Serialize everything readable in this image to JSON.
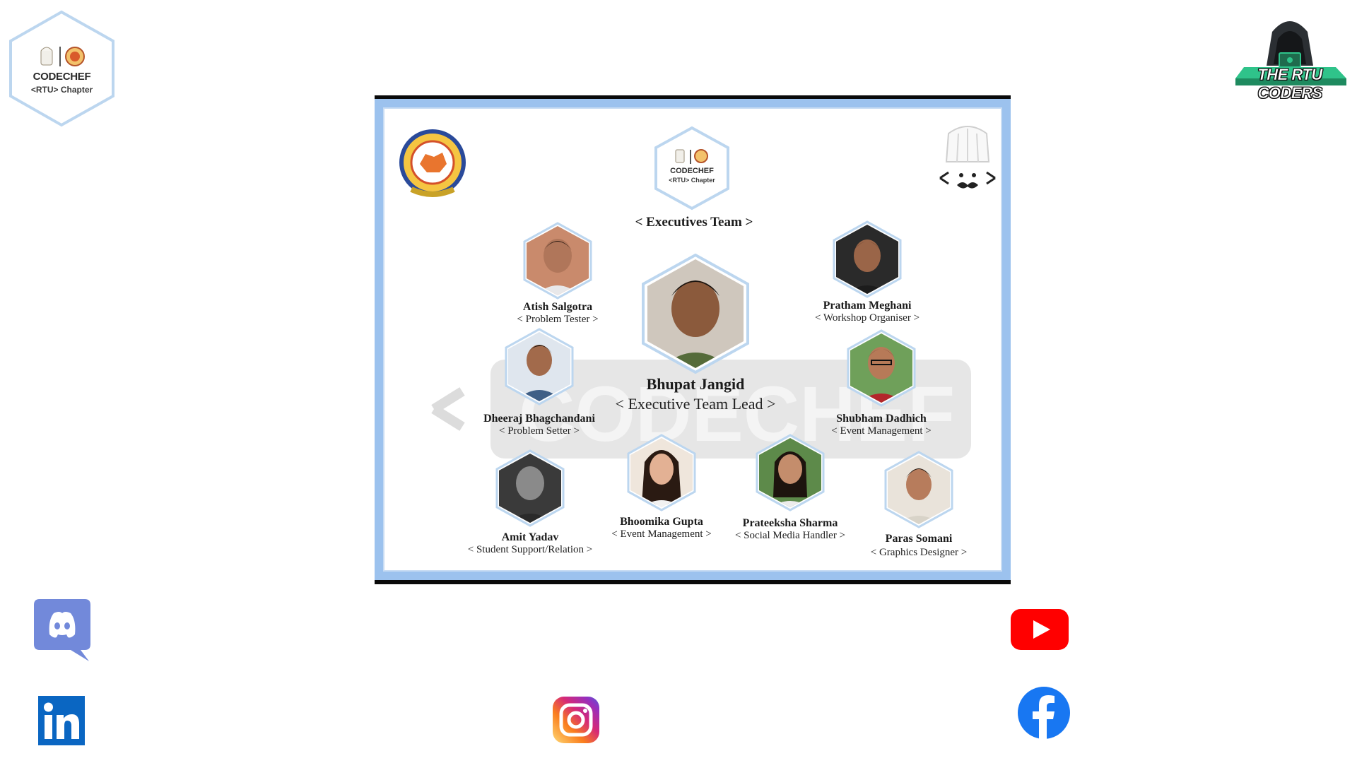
{
  "corner_logos": {
    "codechef_badge": {
      "title": "CODECHEF",
      "subtitle": "<RTU> Chapter"
    },
    "rtu_coders": {
      "text": "THE RTU CODERS"
    }
  },
  "poster": {
    "badge": {
      "title": "CODECHEF",
      "subtitle": "<RTU> Chapter"
    },
    "heading": "< Executives Team >",
    "members": [
      {
        "name": "Bhupat Jangid",
        "role": "< Executive Team Lead >"
      },
      {
        "name": "Atish Salgotra",
        "role": "< Problem Tester >"
      },
      {
        "name": "Pratham Meghani",
        "role": "< Workshop Organiser >"
      },
      {
        "name": "Dheeraj Bhagchandani",
        "role": "< Problem Setter >"
      },
      {
        "name": "Shubham Dadhich",
        "role": "< Event Management >"
      },
      {
        "name": "Amit Yadav",
        "role": "< Student Support/Relation >"
      },
      {
        "name": "Bhoomika Gupta",
        "role": "< Event Management >"
      },
      {
        "name": "Prateeksha Sharma",
        "role": "< Social Media Handler >"
      },
      {
        "name": "Paras Somani",
        "role": "< Graphics Designer >"
      }
    ]
  },
  "social_links": [
    {
      "icon": "discord-icon",
      "color": "#7289DA"
    },
    {
      "icon": "youtube-icon",
      "color": "#FF0000"
    },
    {
      "icon": "linkedin-icon",
      "color": "#0A66C2"
    },
    {
      "icon": "instagram-icon",
      "color": "#E1306C"
    },
    {
      "icon": "facebook-icon",
      "color": "#1877F2"
    }
  ]
}
